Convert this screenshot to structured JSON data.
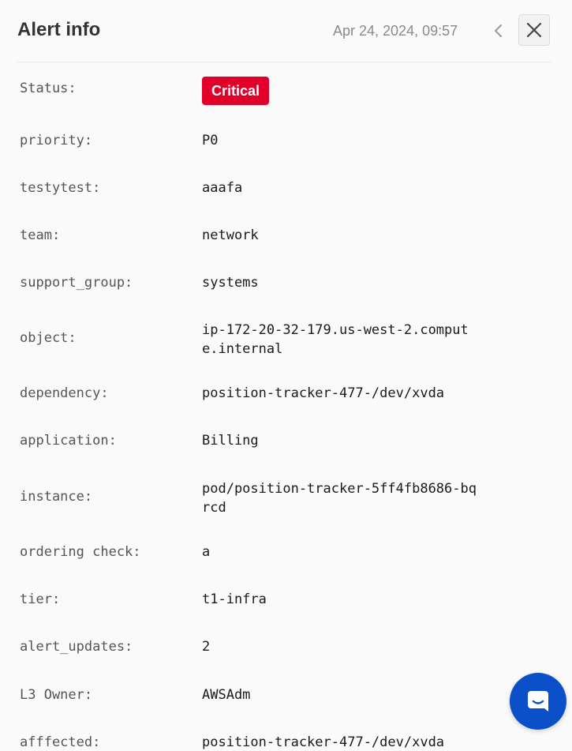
{
  "header": {
    "title": "Alert info",
    "timestamp": "Apr 24, 2024, 09:57",
    "prev_icon": "chevron-left-icon",
    "close_icon": "close-icon"
  },
  "status": {
    "label": "Status:",
    "value": "Critical",
    "badge_color": "#e0002a"
  },
  "fields": [
    {
      "label": "priority:",
      "value": "P0"
    },
    {
      "label": "testytest:",
      "value": "aaafa"
    },
    {
      "label": "team:",
      "value": "network"
    },
    {
      "label": "support_group:",
      "value": "systems"
    },
    {
      "label": "object:",
      "value_lines": [
        "ip-172-20-32-179.us-west-2.comput",
        "e.internal"
      ]
    },
    {
      "label": "dependency:",
      "value": "position-tracker-477-/dev/xvda"
    },
    {
      "label": "application:",
      "value": "Billing"
    },
    {
      "label": "instance:",
      "value_lines": [
        "pod/position-tracker-5ff4fb8686-bq",
        "rcd"
      ]
    },
    {
      "label": "ordering check:",
      "value": "a"
    },
    {
      "label": "tier:",
      "value": "t1-infra"
    },
    {
      "label": "alert_updates:",
      "value": "2"
    },
    {
      "label": "L3 Owner:",
      "value": "AWSAdm"
    },
    {
      "label": "afffected:",
      "value": "position-tracker-477-/dev/xvda"
    }
  ],
  "chat": {
    "icon": "chat-icon",
    "color": "#0b4fc9"
  }
}
